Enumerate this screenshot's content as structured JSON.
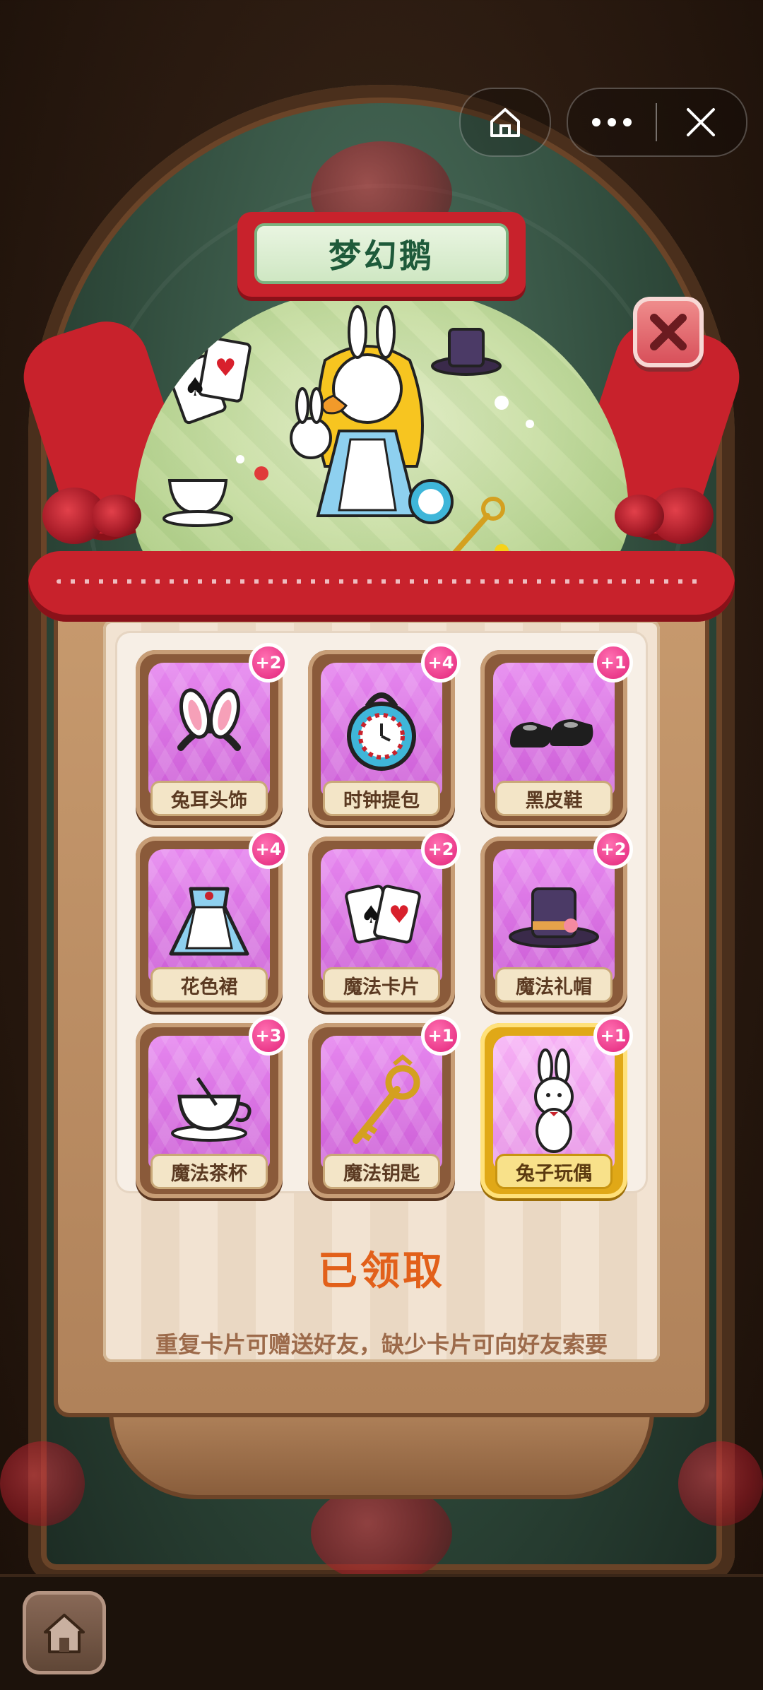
{
  "app": {
    "title": "梦幻鹅",
    "status": "已领取",
    "hint": "重复卡片可赠送好友，缺少卡片可向好友索要"
  },
  "toolbar": {
    "home_icon": "home-icon",
    "more_icon": "more-icon",
    "close_icon": "close-icon"
  },
  "cards": [
    {
      "label": "兔耳头饰",
      "count": "+2",
      "icon": "bunny-ears-icon"
    },
    {
      "label": "时钟提包",
      "count": "+4",
      "icon": "clock-bag-icon"
    },
    {
      "label": "黑皮鞋",
      "count": "+1",
      "icon": "black-shoes-icon"
    },
    {
      "label": "花色裙",
      "count": "+4",
      "icon": "dress-icon"
    },
    {
      "label": "魔法卡片",
      "count": "+2",
      "icon": "playing-cards-icon"
    },
    {
      "label": "魔法礼帽",
      "count": "+2",
      "icon": "top-hat-icon"
    },
    {
      "label": "魔法茶杯",
      "count": "+3",
      "icon": "teacup-icon"
    },
    {
      "label": "魔法钥匙",
      "count": "+1",
      "icon": "key-icon"
    },
    {
      "label": "兔子玩偶",
      "count": "+1",
      "icon": "bunny-doll-icon"
    }
  ],
  "colors": {
    "ribbon": "#c8222c",
    "card_purple": "#cc5dd6",
    "badge": "#e2237a",
    "status": "#e2601a",
    "gold": "#e0a817"
  }
}
